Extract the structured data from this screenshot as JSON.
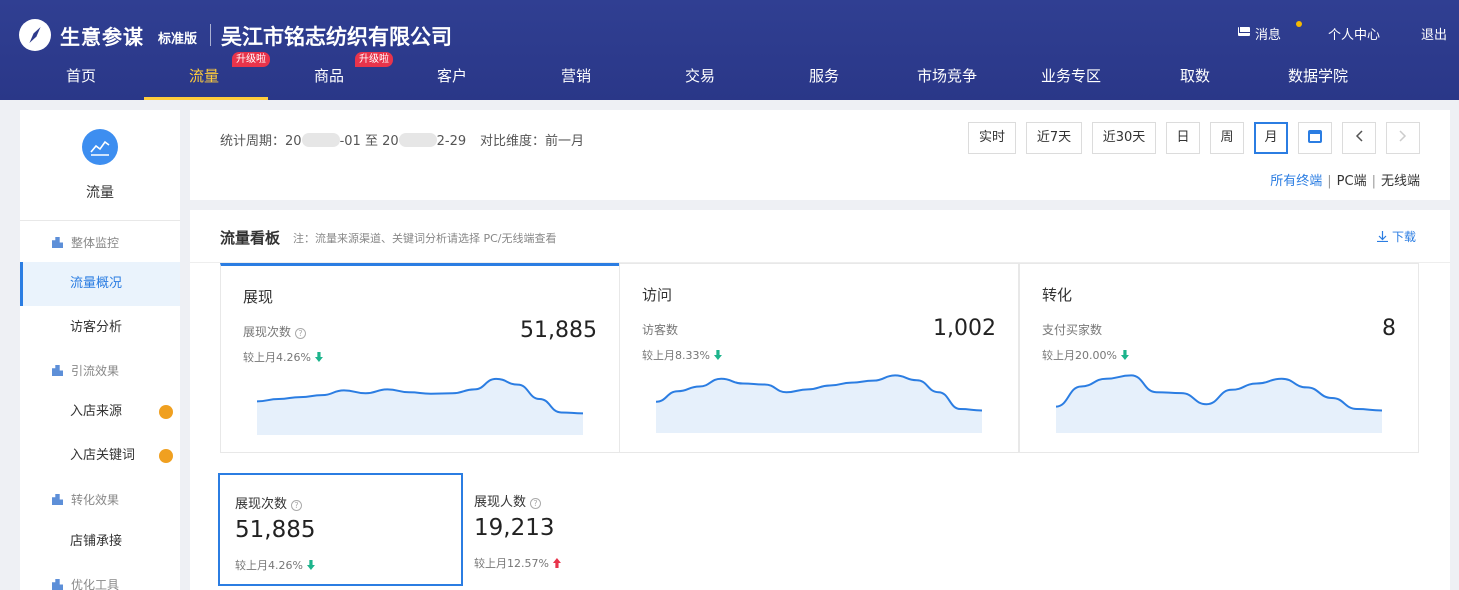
{
  "header": {
    "brand": "生意参谋",
    "edition": "标准版",
    "company": "吴江市铭志纺织有限公司",
    "links": {
      "messages": "消息",
      "personal_center": "个人中心",
      "logout": "退出"
    },
    "nav": [
      {
        "label": "首页"
      },
      {
        "label": "流量",
        "badge": "升级啦",
        "active": true
      },
      {
        "label": "商品",
        "badge": "升级啦"
      },
      {
        "label": "客户"
      },
      {
        "label": "营销"
      },
      {
        "label": "交易"
      },
      {
        "label": "服务"
      },
      {
        "label": "市场竞争"
      },
      {
        "label": "业务专区"
      },
      {
        "label": "取数"
      },
      {
        "label": "数据学院"
      }
    ]
  },
  "sidebar": {
    "title": "流量",
    "groups": [
      {
        "label": "整体监控",
        "items": [
          {
            "label": "流量概况",
            "active": true
          },
          {
            "label": "访客分析"
          }
        ]
      },
      {
        "label": "引流效果",
        "items": [
          {
            "label": "入店来源",
            "dot": true
          },
          {
            "label": "入店关键词",
            "dot": true
          }
        ]
      },
      {
        "label": "转化效果",
        "items": [
          {
            "label": "店铺承接"
          }
        ]
      },
      {
        "label": "优化工具",
        "items": []
      }
    ]
  },
  "period": {
    "label": "统计周期：",
    "start_prefix": "20",
    "start_suffix": "-01",
    "to": "至",
    "end_prefix": "20",
    "end_suffix": "2-29",
    "compare": "对比维度：前一月",
    "buttons": {
      "realtime": "实时",
      "last7": "近7天",
      "last30": "近30天",
      "day": "日",
      "week": "周",
      "month": "月"
    },
    "terminals": {
      "all": "所有终端",
      "pc": "PC端",
      "wireless": "无线端"
    }
  },
  "panel": {
    "title": "流量看板",
    "note": "注：流量来源渠道、关键词分析请选择 PC/无线端查看",
    "download": "下载"
  },
  "cards": [
    {
      "title": "展现",
      "label": "展现次数",
      "value": "51,885",
      "compare": "较上月4.26%",
      "trend": "down",
      "spark": [
        0.55,
        0.5,
        0.46,
        0.42,
        0.32,
        0.38,
        0.3,
        0.36,
        0.39,
        0.38,
        0.3,
        0.08,
        0.2,
        0.5,
        0.78,
        0.8
      ]
    },
    {
      "title": "访问",
      "label": "访客数",
      "value": "1,002",
      "compare": "较上月8.33%",
      "trend": "down",
      "spark": [
        0.6,
        0.38,
        0.28,
        0.12,
        0.22,
        0.24,
        0.4,
        0.34,
        0.26,
        0.2,
        0.16,
        0.05,
        0.15,
        0.4,
        0.75,
        0.78
      ]
    },
    {
      "title": "转化",
      "label": "支付买家数",
      "value": "8",
      "compare": "较上月20.00%",
      "trend": "down",
      "spark": [
        0.7,
        0.28,
        0.12,
        0.05,
        0.4,
        0.42,
        0.65,
        0.35,
        0.22,
        0.12,
        0.3,
        0.52,
        0.75,
        0.78
      ]
    }
  ],
  "metrics": [
    {
      "label": "展现次数",
      "value": "51,885",
      "compare": "较上月4.26%",
      "trend": "down",
      "active": true
    },
    {
      "label": "展现人数",
      "value": "19,213",
      "compare": "较上月12.57%",
      "trend": "up"
    }
  ],
  "colors": {
    "header_bg": "#2e3b8c",
    "accent": "#2b7de2",
    "nav_active": "#ffcd3c",
    "badge": "#e8344b",
    "down": "#1db48c",
    "up": "#e8344b"
  }
}
